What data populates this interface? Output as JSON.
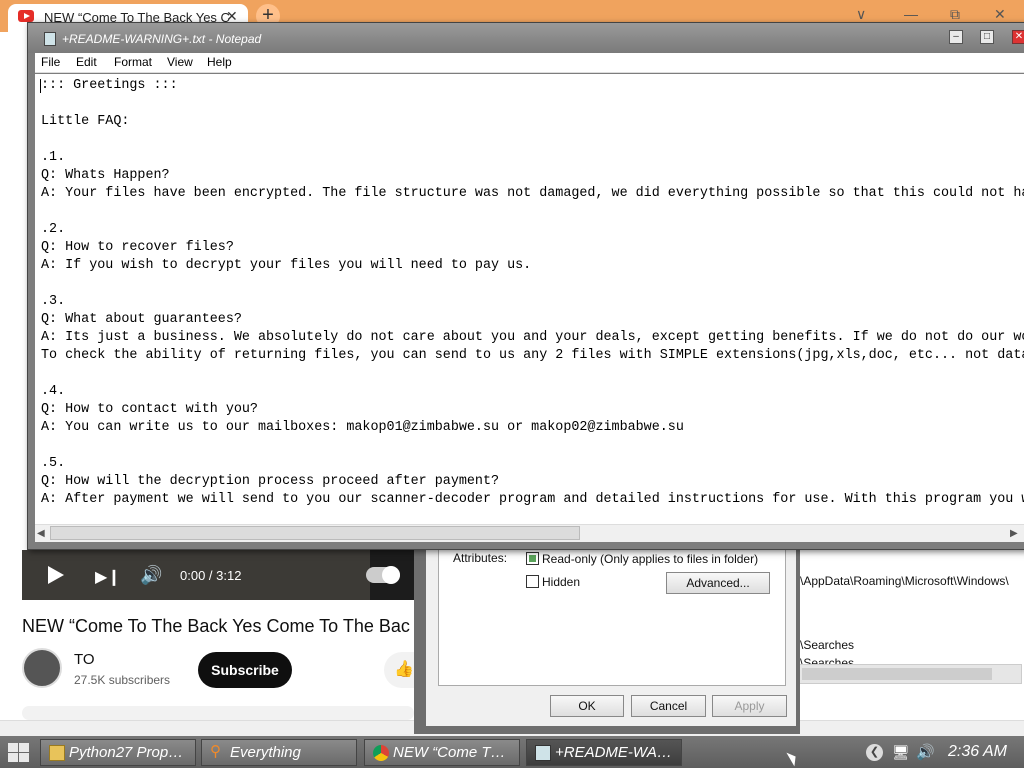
{
  "browser": {
    "tab_title": "NEW “Come To The Back Yes C",
    "tab_close": "✕",
    "new_tab": "+",
    "controls": {
      "minimize": "∨",
      "restore": "—",
      "maximize": "⧉",
      "close": "✕"
    },
    "video": {
      "time": "0:00 / 3:12",
      "title": "NEW “Come To The Back Yes Come To The Bac",
      "channel_name": "TO",
      "subscribers": "27.5K subscribers",
      "subscribe_label": "Subscribe",
      "like_icon": "👍"
    }
  },
  "explorer_bg": {
    "path": "\\AppData\\Roaming\\Microsoft\\Windows\\",
    "item1": "\\Searches",
    "item2": "\\Searches"
  },
  "properties_dialog": {
    "attributes_label": "Attributes:",
    "readonly_label": "Read-only (Only applies to files in folder)",
    "readonly_checked": true,
    "hidden_label": "Hidden",
    "hidden_checked": false,
    "advanced_label": "Advanced...",
    "ok_label": "OK",
    "cancel_label": "Cancel",
    "apply_label": "Apply"
  },
  "notepad": {
    "title": "+README-WARNING+.txt - Notepad",
    "menu": [
      "File",
      "Edit",
      "Format",
      "View",
      "Help"
    ],
    "lines": [
      "::: Greetings :::",
      "",
      "Little FAQ:",
      "",
      ".1.",
      "Q: Whats Happen?",
      "A: Your files have been encrypted. The file structure was not damaged, we did everything possible so that this could not ha",
      "",
      ".2.",
      "Q: How to recover files?",
      "A: If you wish to decrypt your files you will need to pay us.",
      "",
      ".3.",
      "Q: What about guarantees?",
      "A: Its just a business. We absolutely do not care about you and your deals, except getting benefits. If we do not do our wo",
      "To check the ability of returning files, you can send to us any 2 files with SIMPLE extensions(jpg,xls,doc, etc... not data",
      "",
      ".4.",
      "Q: How to contact with you?",
      "A: You can write us to our mailboxes: makop01@zimbabwe.su or makop02@zimbabwe.su",
      "",
      ".5.",
      "Q: How will the decryption process proceed after payment?",
      "A: After payment we will send to you our scanner-decoder program and detailed instructions for use. With this program you w"
    ]
  },
  "taskbar": {
    "items": [
      {
        "label": "Python27 Prop…",
        "icon": "folder-icon"
      },
      {
        "label": "Everything",
        "icon": "search-icon"
      },
      {
        "label": "NEW “Come T…",
        "icon": "chrome-icon"
      },
      {
        "label": "+README-WA…",
        "icon": "notepad-icon"
      }
    ],
    "clock": "2:36 AM"
  },
  "colors": {
    "browser_accent": "#f0a35e",
    "taskbar": "#6a6a6a",
    "notepad_titlebar": "#8a8a8a",
    "subscribe_bg": "#0f0f0f"
  }
}
